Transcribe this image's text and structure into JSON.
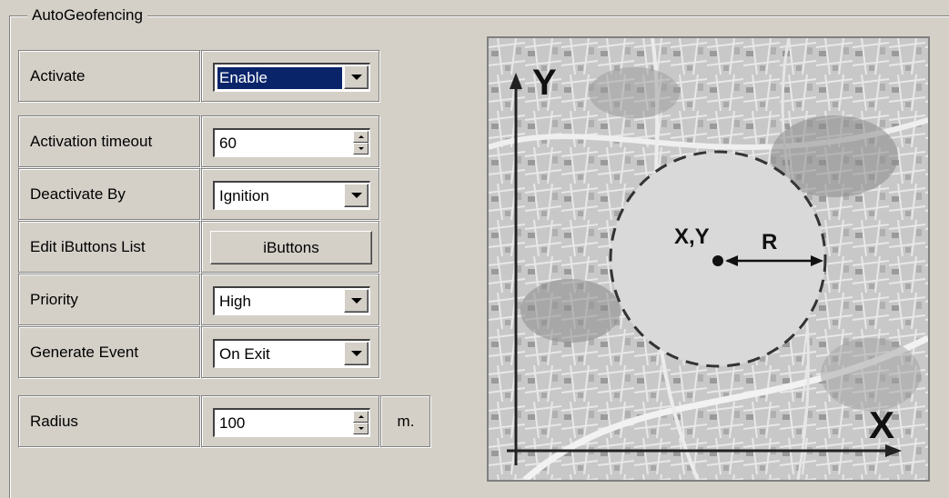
{
  "group": {
    "title": "AutoGeofencing"
  },
  "rows": {
    "activate": {
      "label": "Activate",
      "value": "Enable"
    },
    "activation_timeout": {
      "label": "Activation timeout",
      "value": "60"
    },
    "deactivate_by": {
      "label": "Deactivate By",
      "value": "Ignition"
    },
    "edit_ibuttons": {
      "label": "Edit iButtons List",
      "button": "iButtons"
    },
    "priority": {
      "label": "Priority",
      "value": "High"
    },
    "generate_event": {
      "label": "Generate Event",
      "value": "On Exit"
    },
    "radius": {
      "label": "Radius",
      "value": "100",
      "unit": "m."
    }
  },
  "diagram": {
    "y_axis_label": "Y",
    "x_axis_label": "X",
    "center_label": "X,Y",
    "radius_label": "R"
  },
  "colors": {
    "selection": "#0a246a",
    "face": "#d4d0c8"
  }
}
